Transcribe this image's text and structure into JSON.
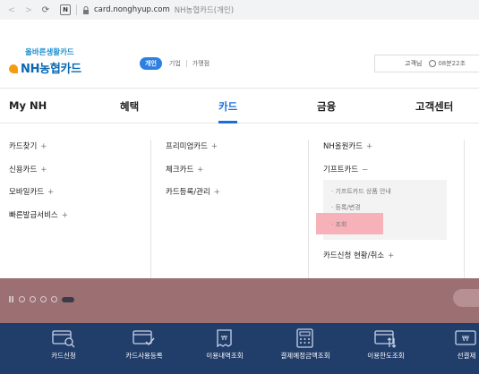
{
  "browser": {
    "url": "card.nonghyup.com",
    "title": "NH농협카드(개인)",
    "site_badge": "N"
  },
  "header": {
    "slogan": "올바른생활카드",
    "brand": "NH농협카드",
    "tabs": [
      "개인",
      "기업",
      "가맹점"
    ],
    "util_customer": "고객님",
    "util_time": "08분22초"
  },
  "nav": {
    "items": [
      "My NH",
      "혜택",
      "카드",
      "금융",
      "고객센터"
    ]
  },
  "dropdown": {
    "col1": [
      "카드찾기",
      "신용카드",
      "모바일카드",
      "빠른발급서비스"
    ],
    "col2": [
      "프리미엄카드",
      "체크카드",
      "카드등록/관리"
    ],
    "col3": [
      "NH올원카드",
      "기프트카드"
    ],
    "col3_signs": [
      "+",
      "−"
    ],
    "plus": "+",
    "submenu": [
      "기프트카드 상품 안내",
      "등록/변경",
      "조회"
    ],
    "status": "카드신청 현황/취소"
  },
  "quick_menu": {
    "items": [
      "카드신청",
      "카드사용등록",
      "이용내역조회",
      "결제예정금액조회",
      "이용한도조회",
      "선결제"
    ]
  },
  "colors": {
    "accent": "#1a6fd6",
    "highlight": "#f6b2b8",
    "quick_bg": "#213d6a",
    "banner_bg": "#9c6f73"
  }
}
